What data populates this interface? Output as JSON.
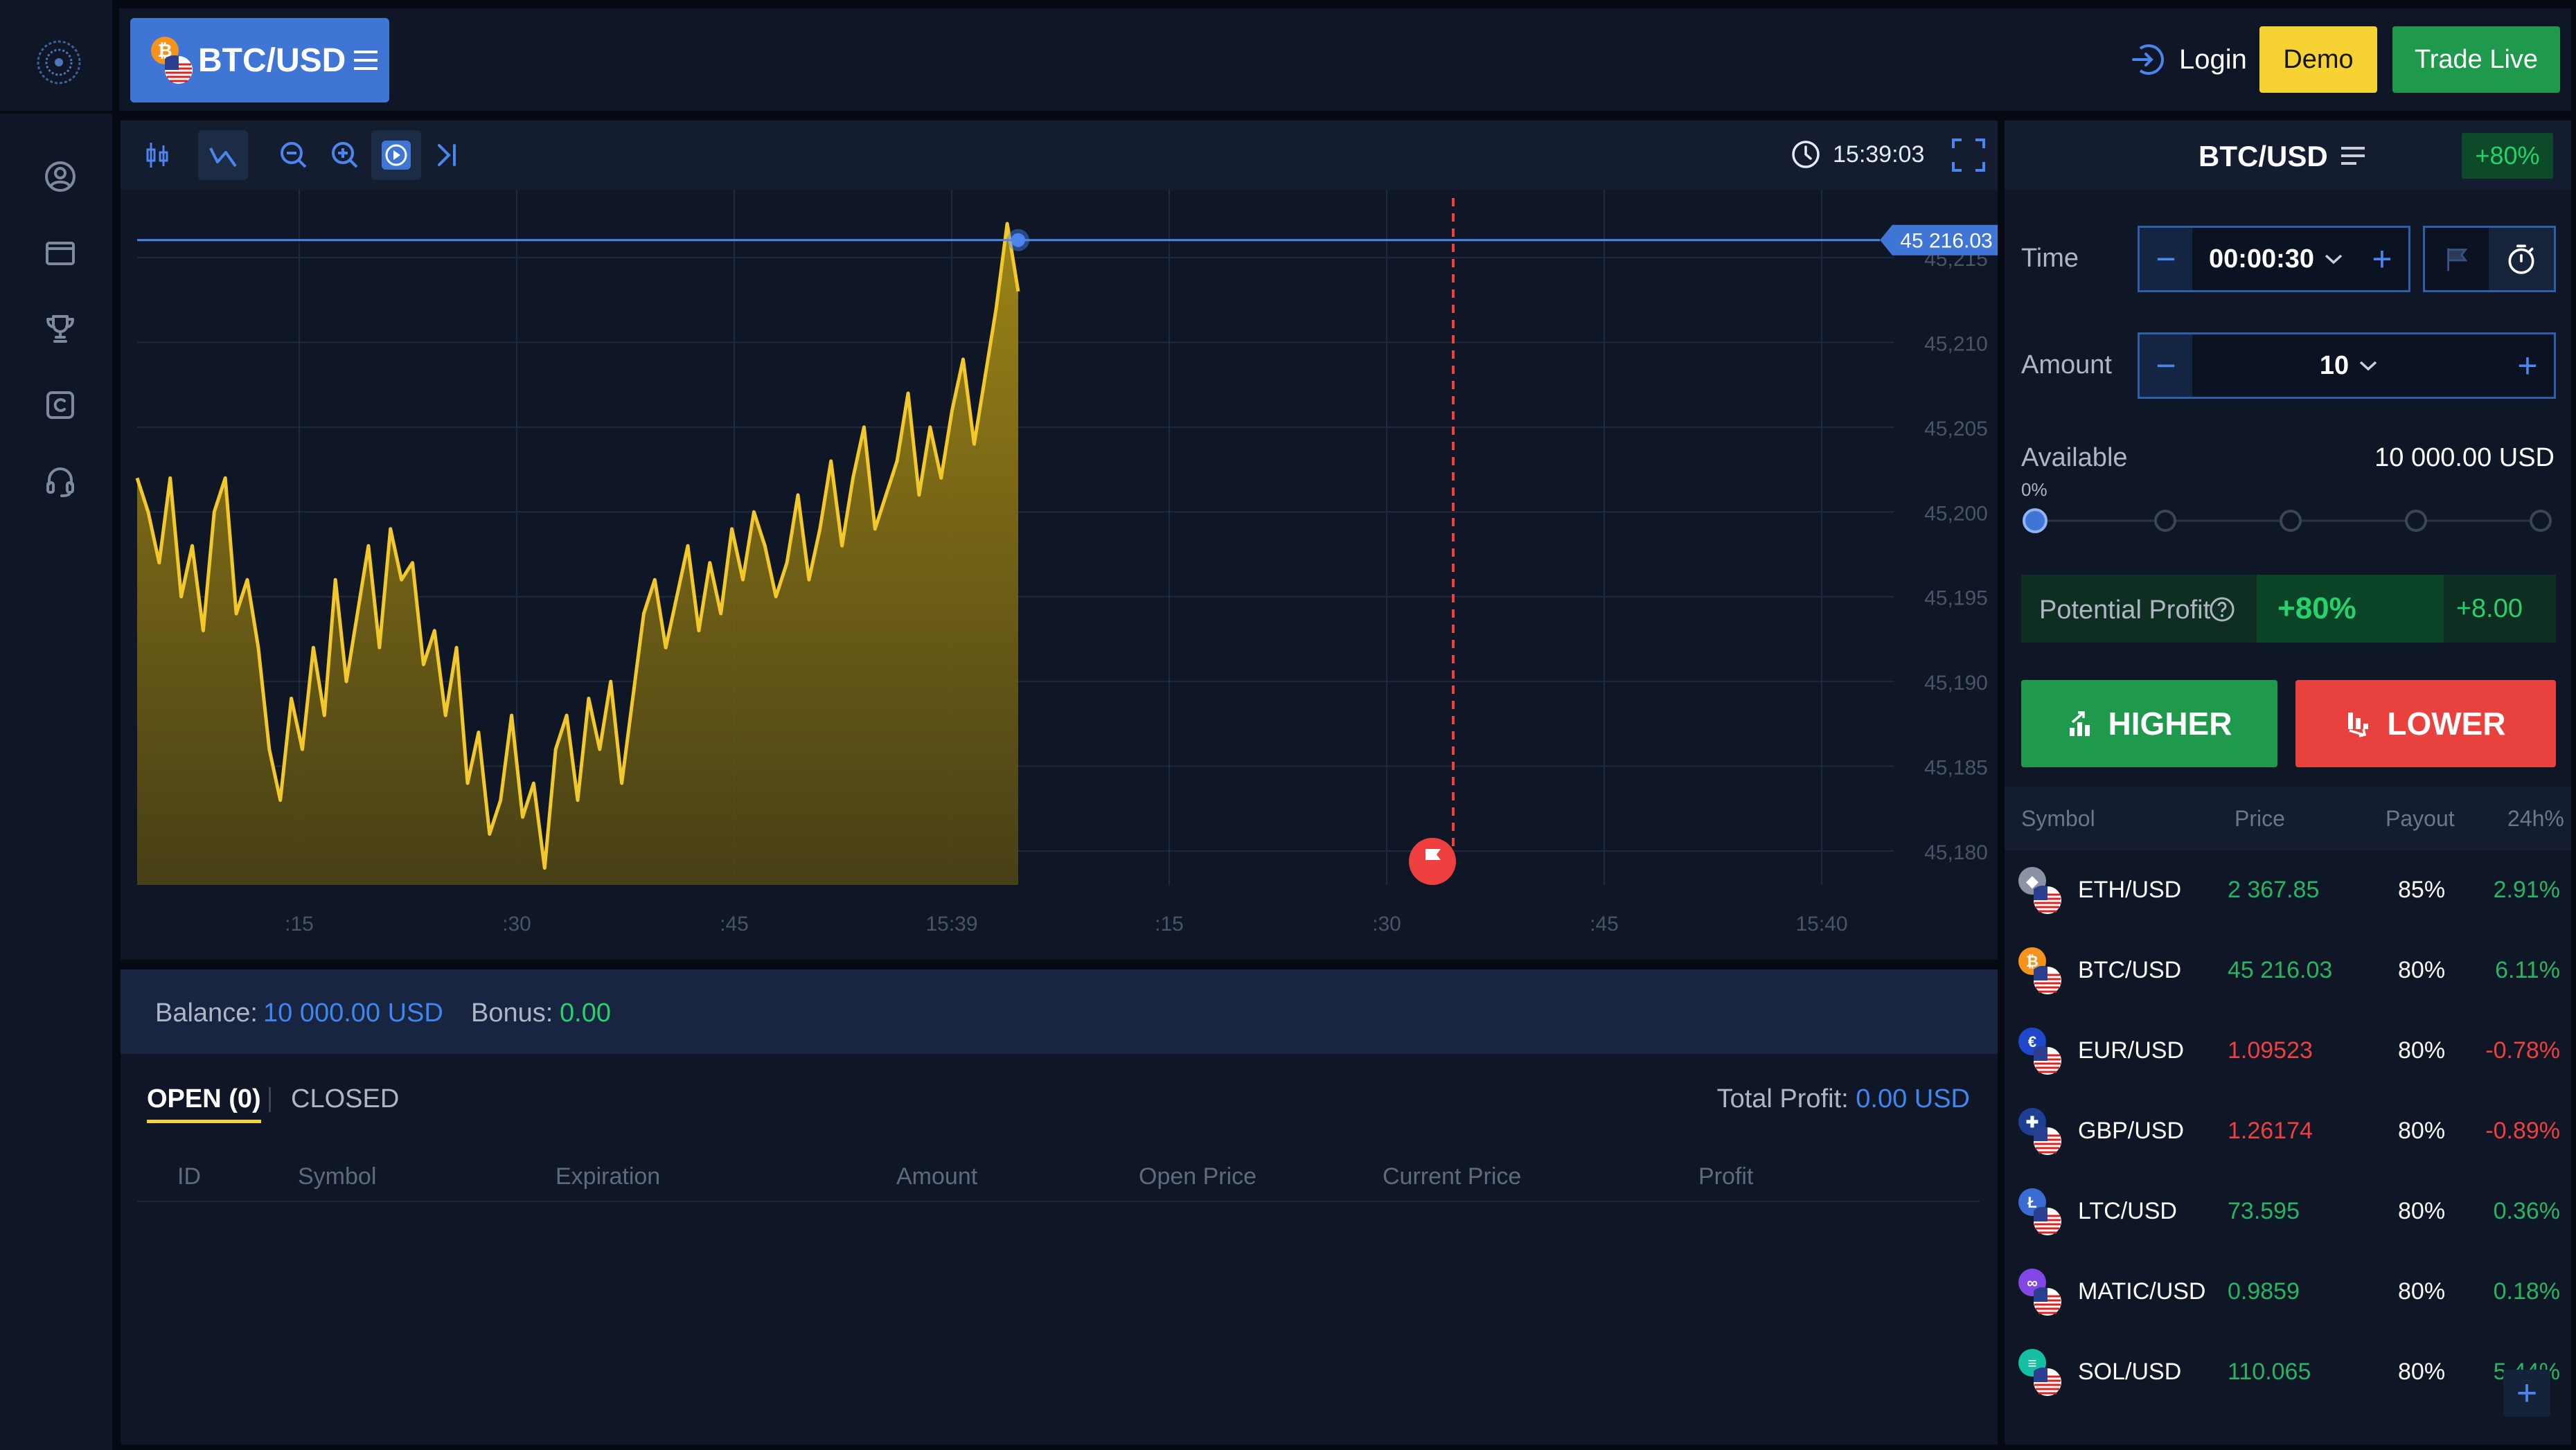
{
  "header": {
    "symbol": "BTC/USD",
    "login_label": "Login",
    "demo_label": "Demo",
    "trade_live_label": "Trade Live"
  },
  "chart_toolbar": {
    "time": "15:39:03"
  },
  "chart_data": {
    "type": "area",
    "current_price": "45 216.03",
    "y_ticks": [
      "45,215",
      "45,210",
      "45,205",
      "45,200",
      "45,195",
      "45,190",
      "45,185",
      "45,180"
    ],
    "x_ticks": [
      ":15",
      ":30",
      ":45",
      "15:39",
      ":15",
      ":30",
      ":45",
      "15:40"
    ],
    "ylim": [
      45178,
      45219
    ],
    "x": [
      0,
      1,
      2,
      3,
      4,
      5,
      6,
      7,
      8,
      9,
      10,
      11,
      12,
      13,
      14,
      15,
      16,
      17,
      18,
      19,
      20,
      21,
      22,
      23,
      24,
      25,
      26,
      27,
      28,
      29,
      30,
      31,
      32,
      33,
      34,
      35,
      36,
      37,
      38,
      39,
      40,
      41,
      42,
      43,
      44,
      45,
      46,
      47,
      48,
      49,
      50,
      51,
      52,
      53,
      54,
      55,
      56,
      57,
      58,
      59,
      60,
      61,
      62,
      63,
      64,
      65,
      66,
      67,
      68,
      69,
      70,
      71,
      72,
      73,
      74,
      75,
      76,
      77,
      78,
      79,
      80
    ],
    "values": [
      45202,
      45200,
      45197,
      45202,
      45195,
      45198,
      45193,
      45200,
      45202,
      45194,
      45196,
      45192,
      45186,
      45183,
      45189,
      45186,
      45192,
      45188,
      45196,
      45190,
      45194,
      45198,
      45192,
      45199,
      45196,
      45197,
      45191,
      45193,
      45188,
      45192,
      45184,
      45187,
      45181,
      45183,
      45188,
      45182,
      45184,
      45179,
      45186,
      45188,
      45183,
      45189,
      45186,
      45190,
      45184,
      45189,
      45194,
      45196,
      45192,
      45195,
      45198,
      45193,
      45197,
      45194,
      45199,
      45196,
      45200,
      45198,
      45195,
      45197,
      45201,
      45196,
      45199,
      45203,
      45198,
      45202,
      45205,
      45199,
      45201,
      45203,
      45207,
      45201,
      45205,
      45202,
      45206,
      45209,
      45204,
      45208,
      45212,
      45217,
      45213
    ],
    "expiry_x_tick": ":30",
    "line_color": "#f2c82a"
  },
  "trade": {
    "symbol": "BTC/USD",
    "payout": "+80%",
    "time_label": "Time",
    "time_value": "00:00:30",
    "amount_label": "Amount",
    "amount_value": "10",
    "available_label": "Available",
    "available_value": "10 000.00 USD",
    "slider_pct": "0%",
    "potential_profit_label": "Potential Profit",
    "potential_profit_pct": "+80%",
    "potential_profit_value": "+8.00",
    "higher_label": "HIGHER",
    "lower_label": "LOWER"
  },
  "markets": {
    "headers": [
      "Symbol",
      "Price",
      "Payout",
      "24h%"
    ],
    "rows": [
      {
        "symbol": "ETH/USD",
        "price": "2 367.85",
        "payout": "85%",
        "change": "2.91%",
        "dir": "up",
        "coin": "#8a93a6",
        "glyph": "◆"
      },
      {
        "symbol": "BTC/USD",
        "price": "45 216.03",
        "payout": "80%",
        "change": "6.11%",
        "dir": "up",
        "coin": "#f7931a",
        "glyph": "₿"
      },
      {
        "symbol": "EUR/USD",
        "price": "1.09523",
        "payout": "80%",
        "change": "-0.78%",
        "dir": "dn",
        "coin": "#1f47c9",
        "glyph": "€"
      },
      {
        "symbol": "GBP/USD",
        "price": "1.26174",
        "payout": "80%",
        "change": "-0.89%",
        "dir": "dn",
        "coin": "#1d3f94",
        "glyph": "✚"
      },
      {
        "symbol": "LTC/USD",
        "price": "73.595",
        "payout": "80%",
        "change": "0.36%",
        "dir": "up",
        "coin": "#3a6bd0",
        "glyph": "Ł"
      },
      {
        "symbol": "MATIC/USD",
        "price": "0.9859",
        "payout": "80%",
        "change": "0.18%",
        "dir": "up",
        "coin": "#8247e5",
        "glyph": "∞"
      },
      {
        "symbol": "SOL/USD",
        "price": "110.065",
        "payout": "80%",
        "change": "5.44%",
        "dir": "up",
        "coin": "#14c0a3",
        "glyph": "≡"
      }
    ]
  },
  "balance": {
    "balance_label": "Balance:",
    "balance_value": "10 000.00 USD",
    "bonus_label": "Bonus:",
    "bonus_value": "0.00"
  },
  "positions": {
    "tab_open": "OPEN (0)",
    "tab_closed": "CLOSED",
    "total_profit_label": "Total Profit:",
    "total_profit_value": "0.00 USD",
    "columns": [
      "ID",
      "Symbol",
      "Expiration",
      "Amount",
      "Open Price",
      "Current Price",
      "Profit"
    ]
  },
  "colors": {
    "accent_blue": "#3f76d6",
    "higher_green": "#1f9a4c",
    "lower_red": "#e9413e",
    "demo_yellow": "#f7d233"
  }
}
